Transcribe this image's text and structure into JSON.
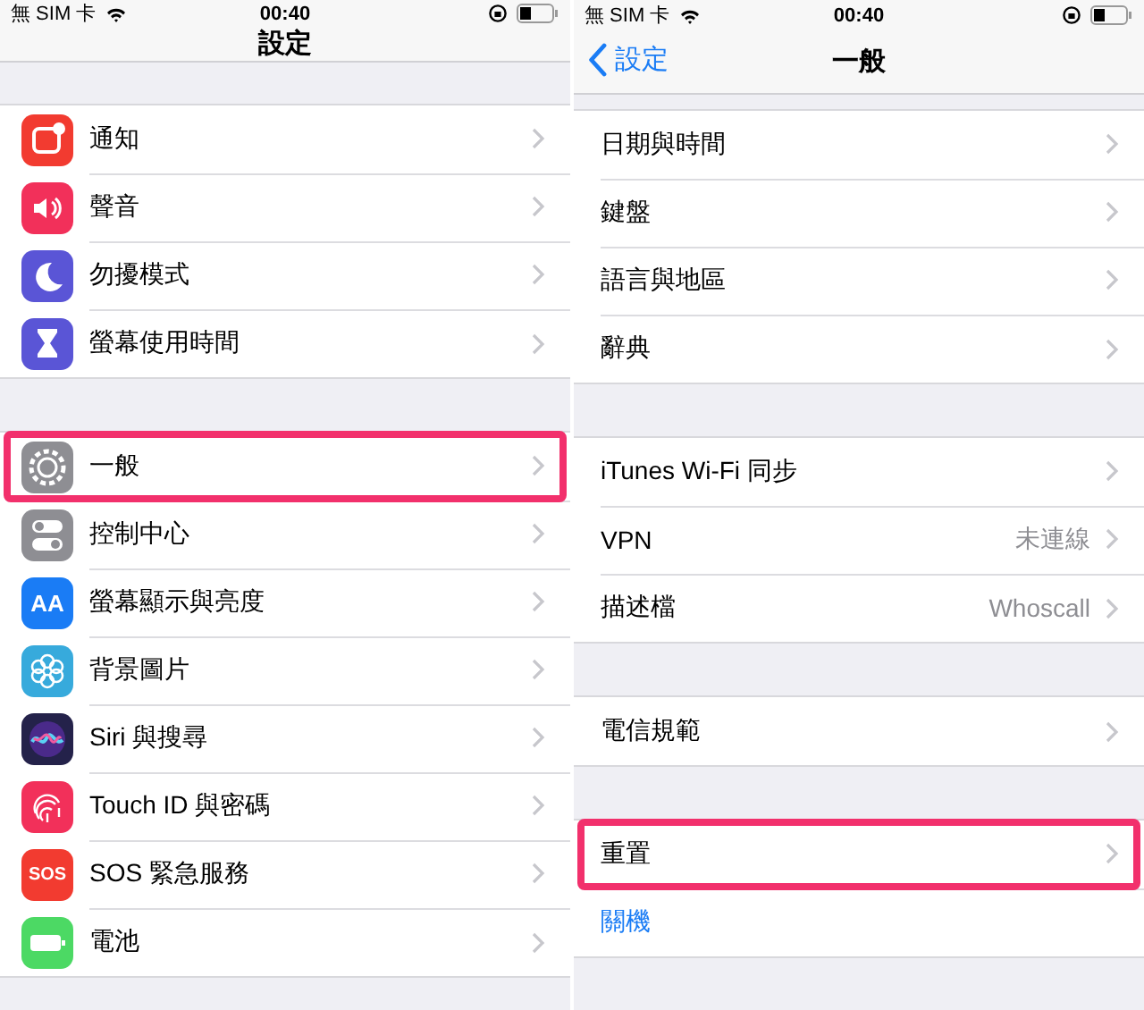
{
  "panels": [
    {
      "status_bar": {
        "carrier": "無 SIM 卡",
        "time": "00:40"
      },
      "nav": {
        "title": "設定"
      },
      "groups": [
        {
          "rows": [
            {
              "label": "通知",
              "color": "#f23b30",
              "highlighted": false
            },
            {
              "label": "聲音",
              "color": "#f2305a",
              "highlighted": false
            },
            {
              "label": "勿擾模式",
              "color": "#5a55d6",
              "highlighted": false
            },
            {
              "label": "螢幕使用時間",
              "color": "#5a55d6",
              "highlighted": false
            }
          ]
        },
        {
          "rows": [
            {
              "label": "一般",
              "color": "#8e8e93",
              "highlighted": true
            },
            {
              "label": "控制中心",
              "color": "#8e8e93",
              "highlighted": false
            },
            {
              "label": "螢幕顯示與亮度",
              "color": "#1a7cf5",
              "highlighted": false,
              "icon_text": "AA"
            },
            {
              "label": "背景圖片",
              "color": "#37aadc",
              "highlighted": false
            },
            {
              "label": "Siri 與搜尋",
              "color": "#24224a",
              "highlighted": false
            },
            {
              "label": "Touch ID 與密碼",
              "color": "#f2305a",
              "highlighted": false
            },
            {
              "label": "SOS 緊急服務",
              "color": "#f23b30",
              "highlighted": false,
              "icon_text": "SOS"
            },
            {
              "label": "電池",
              "color": "#4cd964",
              "highlighted": false
            }
          ]
        }
      ]
    },
    {
      "status_bar": {
        "carrier": "無 SIM 卡",
        "time": "00:40"
      },
      "nav": {
        "title": "一般",
        "back": "設定"
      },
      "groups": [
        {
          "rows": [
            {
              "kind": "nav",
              "label": "日期與時間",
              "highlighted": false
            },
            {
              "kind": "nav",
              "label": "鍵盤",
              "highlighted": false
            },
            {
              "kind": "nav",
              "label": "語言與地區",
              "highlighted": false
            },
            {
              "kind": "nav",
              "label": "辭典",
              "highlighted": false
            }
          ]
        },
        {
          "rows": [
            {
              "kind": "nav",
              "label": "iTunes Wi-Fi 同步",
              "highlighted": false
            },
            {
              "kind": "nav",
              "label": "VPN",
              "value": "未連線",
              "highlighted": false
            },
            {
              "kind": "nav",
              "label": "描述檔",
              "value": "Whoscall",
              "highlighted": false
            }
          ]
        },
        {
          "rows": [
            {
              "kind": "nav",
              "label": "電信規範",
              "highlighted": false
            }
          ]
        },
        {
          "rows": [
            {
              "kind": "nav",
              "label": "重置",
              "highlighted": true
            },
            {
              "kind": "link",
              "label": "關機",
              "highlighted": false
            }
          ]
        }
      ]
    }
  ]
}
